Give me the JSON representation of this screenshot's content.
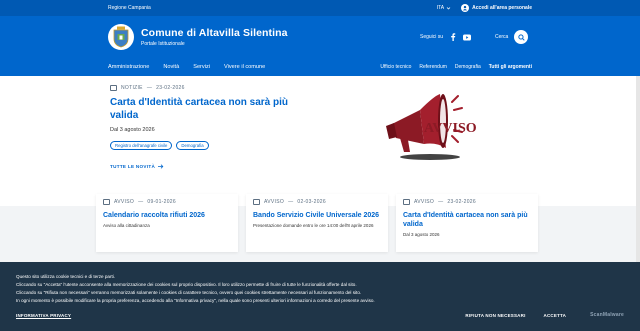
{
  "slim_header": {
    "region": "Regione Campania",
    "lang": "ITA",
    "login": "Accedi all'area personale"
  },
  "header": {
    "title": "Comune di Altavilla Silentina",
    "subtitle": "Portale Istituzionale",
    "social_label": "Seguici su",
    "search_label": "Cerca"
  },
  "nav": {
    "main": [
      "Amministrazione",
      "Novità",
      "Servizi",
      "Vivere il comune"
    ],
    "secondary": [
      "Ufficio tecnico",
      "Referendum",
      "Demografia"
    ],
    "all_topics": "Tutti gli argomenti"
  },
  "hero": {
    "category": "NOTIZIE",
    "date": "23-02-2026",
    "title": "Carta d'Identità cartacea non sarà più valida",
    "subtitle": "Dal 3 agosto 2026",
    "tags": [
      "Registro dell'anagrafe civile",
      "Demografia"
    ],
    "all_news": "TUTTE LE NOVITÀ",
    "image_text": "AVVISO"
  },
  "cards": [
    {
      "category": "AVVISO",
      "date": "09-01-2026",
      "title": "Calendario raccolta rifiuti 2026",
      "desc": "Avviso alla cittadinanza"
    },
    {
      "category": "AVVISO",
      "date": "02-03-2026",
      "title": "Bando Servizio Civile Universale 2026",
      "desc": "Presentazione domande entro le ore 14:00 dell'8 aprile 2026"
    },
    {
      "category": "AVVISO",
      "date": "23-02-2026",
      "title": "Carta d'Identità cartacea non sarà più valida",
      "desc": "Dal 3 agosto 2026"
    }
  ],
  "cookie": {
    "lines": [
      "Questo sito utilizza cookie tecnici e di terze parti.",
      "Cliccando su \"Accetta\" l'utente acconsente alla memorizzazione dei cookies sul proprio dispositivo. Il loro utilizzo permette di fruire di tutte le funzionalità offerte dal sito.",
      "Cliccando su \"Rifiuta non necessari\" verranno memorizzati solamente i cookies di carattere tecnico, ovvero quei cookies strettamente necessari al funzionamento del sito.",
      "In ogni momento è possibile modificare la propria preferenza, accedendo alla \"Informativa privacy\", nella quale sono presenti ulteriori informazioni a corredo del presente avviso."
    ],
    "policy": "INFORMATIVA PRIVACY",
    "reject": "RIFIUTA NON NECESSARI",
    "accept": "ACCETTA",
    "brand": "ScanMalware"
  },
  "colors": {
    "primary": "#0066cc",
    "dark": "#1f3548"
  }
}
